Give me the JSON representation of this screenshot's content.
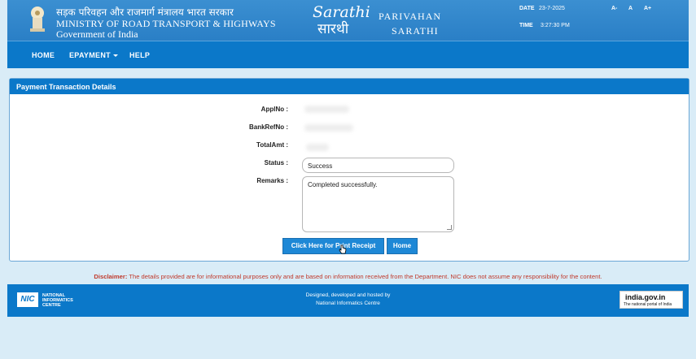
{
  "header": {
    "ministry_hindi": "सड़क परिवहन और राजमार्ग मंत्रालय भारत सरकार",
    "ministry_en": "MINISTRY OF ROAD TRANSPORT & HIGHWAYS",
    "government": "Government of India",
    "logo_script": "Sarathi",
    "logo_hindi": "सारथी",
    "brand_top": "PARIVAHAN",
    "brand_bottom": "SARATHI",
    "date_label": "DATE",
    "date_value": "23-7-2025",
    "time_label": "TIME",
    "time_value": "3:27:30 PM",
    "font_controls": [
      "A-",
      "A",
      "A+"
    ]
  },
  "nav": {
    "home": "HOME",
    "epayment": "EPAYMENT",
    "help": "HELP"
  },
  "panel": {
    "title": "Payment Transaction Details",
    "labels": {
      "appl_no": "ApplNo :",
      "bank_ref_no": "BankRefNo :",
      "total_amt": "TotalAmt :",
      "status": "Status :",
      "remarks": "Remarks :"
    },
    "status_value": "Success",
    "remarks_value": "Completed successfully.",
    "print_button": "Click Here for Print Receipt",
    "home_button": "Home"
  },
  "disclaimer": {
    "label": "Disclaimer:",
    "text": "The details provided are for informational purposes only and are based on information received from the Department. NIC does not assume any responsibility for the content."
  },
  "footer": {
    "nic_logo": "NIC",
    "nic_line1": "NATIONAL",
    "nic_line2": "INFORMATICS",
    "nic_line3": "CENTRE",
    "designed_line1": "Designed, developed and hosted by",
    "designed_line2": "National Informatics Centre",
    "india_main": "india.gov.in",
    "india_sub": "The national portal of India"
  },
  "colors": {
    "header_blue": "#2a7fc6",
    "nav_blue": "#0b78c9",
    "button_blue": "#1e88d6",
    "disclaimer_red": "#c0392b",
    "page_bg": "#d9ecf7"
  }
}
